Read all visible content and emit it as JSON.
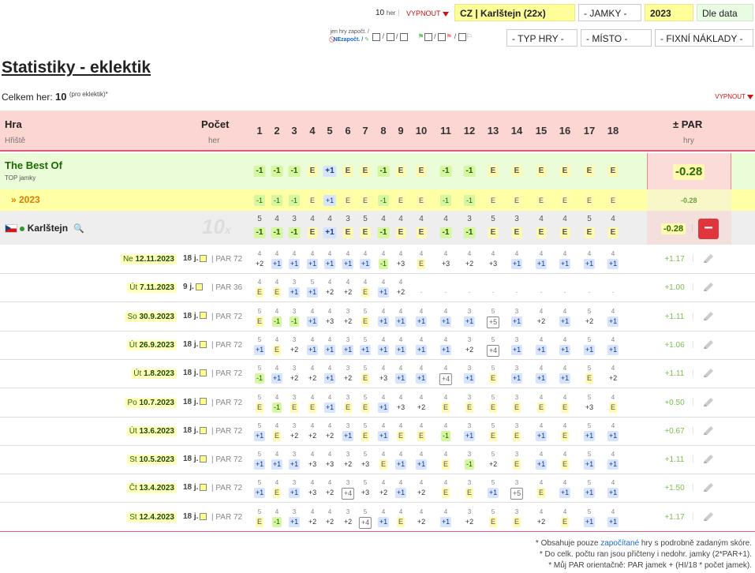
{
  "filters": {
    "count": "10",
    "count_unit": "her",
    "off_label": "VYPNOUT",
    "course": "CZ | Karlštejn (22x)",
    "holes": "- JAMKY -",
    "year": "2023",
    "sort": "Dle data",
    "game_type": "- TYP HRY -",
    "place": "- MÍSTO -",
    "fixed_costs": "- FIXNÍ NÁKLADY -",
    "only_counted": "jen hry započt. /",
    "not_counted": "NEzapočt. /"
  },
  "page": {
    "title": "Statistiky - eklektik",
    "total_label": "Celkem her:",
    "total_value": "10",
    "total_note": "(pro eklektik)*",
    "off_label": "VYPNOUT"
  },
  "header": {
    "game": "Hra",
    "course": "Hřiště",
    "count": "Počet",
    "games": "her",
    "par": "± PAR",
    "par_sub": "hry",
    "holes": [
      "1",
      "2",
      "3",
      "4",
      "5",
      "6",
      "7",
      "8",
      "9",
      "10",
      "11",
      "12",
      "13",
      "14",
      "15",
      "16",
      "17",
      "18"
    ]
  },
  "best": {
    "name": "The Best Of",
    "sub": "TOP jamky",
    "scores": [
      "-1",
      "-1",
      "-1",
      "E",
      "+1",
      "E",
      "E",
      "-1",
      "E",
      "E",
      "-1",
      "-1",
      "E",
      "E",
      "E",
      "E",
      "E",
      "E"
    ],
    "total": "-0.28"
  },
  "year_row": {
    "label": "» 2023",
    "scores": [
      "-1",
      "-1",
      "-1",
      "E",
      "+1",
      "E",
      "E",
      "-1",
      "E",
      "E",
      "-1",
      "-1",
      "E",
      "E",
      "E",
      "E",
      "E",
      "E"
    ],
    "total": "-0.28"
  },
  "club": {
    "name": "Karlštejn",
    "count": "10",
    "count_suffix": "x",
    "pars": [
      "5",
      "4",
      "3",
      "4",
      "4",
      "3",
      "5",
      "4",
      "4",
      "4",
      "4",
      "3",
      "5",
      "3",
      "4",
      "4",
      "5",
      "4"
    ],
    "scores": [
      "-1",
      "-1",
      "-1",
      "E",
      "+1",
      "E",
      "E",
      "-1",
      "E",
      "E",
      "-1",
      "-1",
      "E",
      "E",
      "E",
      "E",
      "E",
      "E"
    ],
    "total": "-0.28",
    "remove": "−"
  },
  "games": [
    {
      "day": "Ne",
      "date": "12.11.2023",
      "holes": "18 j.",
      "par": "PAR 72",
      "diff": "+1.17",
      "pars": [
        "4",
        "4",
        "4",
        "4",
        "4",
        "4",
        "4",
        "4",
        "4",
        "4",
        "4",
        "4",
        "4",
        "4",
        "4",
        "4",
        "4",
        "4"
      ],
      "scores": [
        "+2",
        "+1",
        "+1",
        "+1",
        "+1",
        "+1",
        "+1",
        "-1",
        "+3",
        "E",
        "+3",
        "+2",
        "+3",
        "+1",
        "+1",
        "+1",
        "+1",
        "+1"
      ]
    },
    {
      "day": "Út",
      "date": "7.11.2023",
      "holes": "9 j.",
      "par": "PAR 36",
      "diff": "+1.00",
      "pars": [
        "4",
        "4",
        "3",
        "5",
        "4",
        "4",
        "4",
        "4",
        "4",
        "",
        "",
        "",
        "",
        "",
        "",
        "",
        "",
        ""
      ],
      "scores": [
        "E",
        "E",
        "+1",
        "+1",
        "+2",
        "+2",
        "E",
        "+1",
        "+2",
        "-",
        "-",
        "-",
        "-",
        "-",
        "-",
        "-",
        "-",
        "-"
      ]
    },
    {
      "day": "So",
      "date": "30.9.2023",
      "holes": "18 j.",
      "par": "PAR 72",
      "diff": "+1.11",
      "pars": [
        "5",
        "4",
        "3",
        "4",
        "4",
        "3",
        "5",
        "4",
        "4",
        "4",
        "4",
        "3",
        "5",
        "3",
        "4",
        "4",
        "5",
        "4"
      ],
      "scores": [
        "E",
        "-1",
        "-1",
        "+1",
        "+3",
        "+2",
        "E",
        "+1",
        "+1",
        "+1",
        "+1",
        "+1",
        "+5",
        "+1",
        "+2",
        "+1",
        "+2",
        "+1"
      ]
    },
    {
      "day": "Út",
      "date": "26.9.2023",
      "holes": "18 j.",
      "par": "PAR 72",
      "diff": "+1.06",
      "pars": [
        "5",
        "4",
        "3",
        "4",
        "4",
        "3",
        "5",
        "4",
        "4",
        "4",
        "4",
        "3",
        "5",
        "3",
        "4",
        "4",
        "5",
        "4"
      ],
      "scores": [
        "+1",
        "E",
        "+2",
        "+1",
        "+1",
        "+1",
        "+1",
        "+1",
        "+1",
        "+1",
        "+1",
        "+2",
        "+4",
        "+1",
        "+1",
        "+1",
        "+1",
        "+1"
      ]
    },
    {
      "day": "Út",
      "date": "1.8.2023",
      "holes": "18 j.",
      "par": "PAR 72",
      "diff": "+1.11",
      "pars": [
        "5",
        "4",
        "3",
        "4",
        "4",
        "3",
        "5",
        "4",
        "4",
        "4",
        "4",
        "3",
        "5",
        "3",
        "4",
        "4",
        "5",
        "4"
      ],
      "scores": [
        "-1",
        "+1",
        "+2",
        "+2",
        "+1",
        "+2",
        "E",
        "+3",
        "+1",
        "+1",
        "+4",
        "+1",
        "E",
        "+1",
        "+1",
        "+1",
        "E",
        "+2"
      ]
    },
    {
      "day": "Po",
      "date": "10.7.2023",
      "holes": "18 j.",
      "par": "PAR 72",
      "diff": "+0.50",
      "pars": [
        "5",
        "4",
        "3",
        "4",
        "4",
        "3",
        "5",
        "4",
        "4",
        "4",
        "4",
        "3",
        "5",
        "3",
        "4",
        "4",
        "5",
        "4"
      ],
      "scores": [
        "E",
        "-1",
        "E",
        "E",
        "+1",
        "E",
        "E",
        "+1",
        "+3",
        "+2",
        "E",
        "E",
        "E",
        "E",
        "E",
        "E",
        "+3",
        "E"
      ]
    },
    {
      "day": "Út",
      "date": "13.6.2023",
      "holes": "18 j.",
      "par": "PAR 72",
      "diff": "+0.67",
      "pars": [
        "5",
        "4",
        "3",
        "4",
        "4",
        "3",
        "5",
        "4",
        "4",
        "4",
        "4",
        "3",
        "5",
        "3",
        "4",
        "4",
        "5",
        "4"
      ],
      "scores": [
        "+1",
        "E",
        "+2",
        "+2",
        "+2",
        "+1",
        "E",
        "+1",
        "E",
        "E",
        "-1",
        "+1",
        "E",
        "E",
        "+1",
        "E",
        "+1",
        "+1"
      ]
    },
    {
      "day": "St",
      "date": "10.5.2023",
      "holes": "18 j.",
      "par": "PAR 72",
      "diff": "+1.11",
      "pars": [
        "5",
        "4",
        "3",
        "4",
        "4",
        "3",
        "5",
        "4",
        "4",
        "4",
        "4",
        "3",
        "5",
        "3",
        "4",
        "4",
        "5",
        "4"
      ],
      "scores": [
        "+1",
        "+1",
        "+1",
        "+3",
        "+3",
        "+2",
        "+3",
        "E",
        "+1",
        "+1",
        "E",
        "-1",
        "+2",
        "E",
        "+1",
        "E",
        "+1",
        "+1"
      ]
    },
    {
      "day": "Čt",
      "date": "13.4.2023",
      "holes": "18 j.",
      "par": "PAR 72",
      "diff": "+1.50",
      "pars": [
        "5",
        "4",
        "3",
        "4",
        "4",
        "3",
        "5",
        "4",
        "4",
        "4",
        "4",
        "3",
        "5",
        "3",
        "4",
        "4",
        "5",
        "4"
      ],
      "scores": [
        "+1",
        "E",
        "+1",
        "+3",
        "+2",
        "+4",
        "+3",
        "+2",
        "+1",
        "+2",
        "E",
        "E",
        "+1",
        "+5",
        "E",
        "+1",
        "+1",
        "+1"
      ]
    },
    {
      "day": "St",
      "date": "12.4.2023",
      "holes": "18 j.",
      "par": "PAR 72",
      "diff": "+1.17",
      "pars": [
        "5",
        "4",
        "3",
        "4",
        "4",
        "3",
        "5",
        "4",
        "4",
        "4",
        "4",
        "3",
        "5",
        "3",
        "4",
        "4",
        "5",
        "4"
      ],
      "scores": [
        "E",
        "-1",
        "+1",
        "+2",
        "+2",
        "+2",
        "+4",
        "+1",
        "E",
        "+2",
        "+1",
        "+2",
        "E",
        "E",
        "+2",
        "E",
        "+1",
        "+1"
      ]
    }
  ],
  "footnotes": {
    "n1_pre": "* Obsahuje pouze ",
    "n1_link": "započítané",
    "n1_post": " hry s podrobně zadaným skóre.",
    "n2": "* Do celk. počtu ran jsou přičteny i nedohr. jamky (2*PAR+1).",
    "n3": "* Můj PAR orientačně: PAR jamek + (HI/18 * počet jamek)."
  },
  "colors": {
    "header": "#fcd6d2",
    "best": "#ebfcd8",
    "year": "#ffffa6",
    "club": "#eeeeee",
    "accent": "#e05a7b",
    "remove": "#e0353d"
  }
}
